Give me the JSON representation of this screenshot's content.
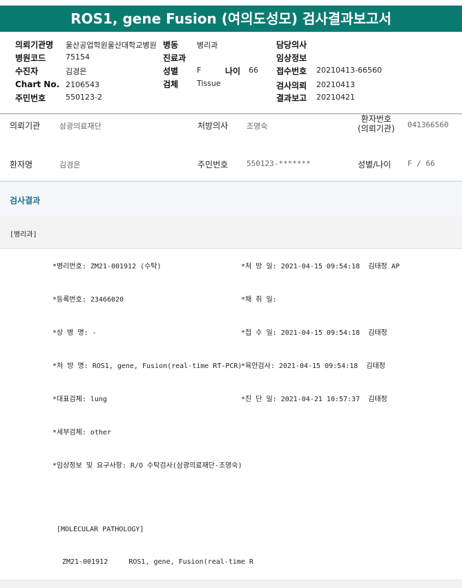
{
  "title": "ROS1, gene Fusion (여의도성모) 검사결과보고서",
  "header": {
    "col1": [
      {
        "label": "의뢰기관명",
        "value": "울산공업학원울산대학교병원"
      },
      {
        "label": "병원코드",
        "value": "75154"
      },
      {
        "label": "수진자",
        "value": "김경은"
      },
      {
        "label": "Chart No.",
        "value": "2106543"
      },
      {
        "label": "주민번호",
        "value": "550123-2"
      }
    ],
    "col2": [
      {
        "label": "병동",
        "value": "병리과"
      },
      {
        "label": "진료과",
        "value": ""
      },
      {
        "label": "성별",
        "value": "F"
      },
      {
        "label": "검체",
        "value": "Tissue"
      }
    ],
    "age_label": "나이",
    "age_value": "66",
    "col3": [
      {
        "label": "담당의사",
        "value": ""
      },
      {
        "label": "임상정보",
        "value": ""
      },
      {
        "label": "접수번호",
        "value": "20210413-66560"
      },
      {
        "label": "검사의뢰",
        "value": "20210413"
      },
      {
        "label": "결과보고",
        "value": "20210421"
      }
    ]
  },
  "patient": {
    "row1": [
      {
        "label": "의뢰기관",
        "value": "삼광의료재단"
      },
      {
        "label": "처방의사",
        "value": "조영숙"
      },
      {
        "label": "환자번호\n(의뢰기관)",
        "value": "041366560"
      }
    ],
    "row2": [
      {
        "label": "환자명",
        "value": "김경은"
      },
      {
        "label": "주민번호",
        "value": "550123-*******"
      },
      {
        "label": "성별/나이",
        "value": "F / 66"
      }
    ]
  },
  "results": {
    "section_title": "검사결과",
    "dept": "[병리과]",
    "rows": [
      {
        "left": "*병리번호: ZM21-001912 (수탁)",
        "right": "*처 방 일: 2021-04-15 09:54:18  김태정 AP"
      },
      {
        "left": "*등록번호: 23466020",
        "right": "*채 취 일:"
      },
      {
        "left": "*상 병 명: -",
        "right": "*접 수 일: 2021-04-15 09:54:18  김태정"
      },
      {
        "left": "*처 방 명: ROS1, gene, Fusion(real-time RT-PCR)",
        "right": "*육안검사: 2021-04-15 09:54:18  김태정"
      },
      {
        "left": "*대표검체: lung",
        "right": "*진 단 일: 2021-04-21 10:57:37  김태정"
      },
      {
        "left": "*세부검체: other",
        "right": ""
      },
      {
        "left": "*임상정보 및 요구사항: R/O 수탁검사(삼광의료재단-조영숙)",
        "right": ""
      },
      {
        "left": "",
        "right": ""
      }
    ],
    "mp_label": "[MOLECULAR PATHOLOGY]",
    "mp_row": "ZM21-001912     ROS1, gene, Fusion(real-time R"
  }
}
